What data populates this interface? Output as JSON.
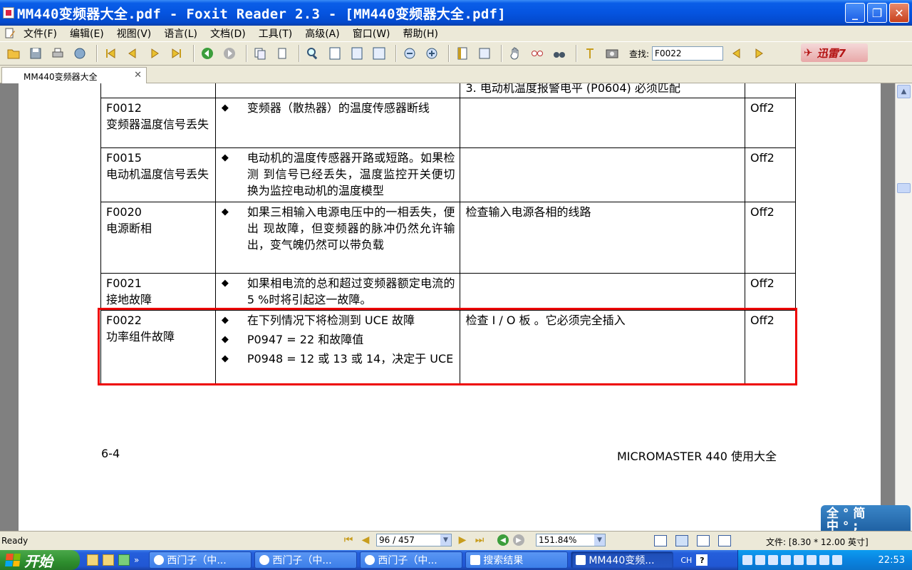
{
  "window": {
    "title": "MM440变频器大全.pdf - Foxit Reader 2.3 - [MM440变频器大全.pdf]",
    "min": "_",
    "max": "❐",
    "close": "✕"
  },
  "menu": [
    "文件(F)",
    "编辑(E)",
    "视图(V)",
    "语言(L)",
    "文档(D)",
    "工具(T)",
    "高级(A)",
    "窗口(W)",
    "帮助(H)"
  ],
  "toolbar": {
    "find_label": "查找:",
    "find_value": "F0022",
    "xunlei": "迅雷7"
  },
  "tab": {
    "label": "MM440变频器大全",
    "close": "✕"
  },
  "table": {
    "top_row_text": "3. 电动机温度报警电平 (P0604) 必须匹配",
    "rows": [
      {
        "code": "F0012",
        "name": "变频器温度信号丢失",
        "causes": [
          "变频器（散热器）的温度传感器断线"
        ],
        "action": "",
        "reaction": "Off2"
      },
      {
        "code": "F0015",
        "name": "电动机温度信号丢失",
        "causes": [
          "电动机的温度传感器开路或短路。如果检测 到信号已经丢失，温度监控开关便切换为监控电动机的温度模型"
        ],
        "action": "",
        "reaction": "Off2"
      },
      {
        "code": "F0020",
        "name": "电源断相",
        "causes": [
          "如果三相输入电源电压中的一相丢失，便出 现故障，但变频器的脉冲仍然允许输出，变气魄仍然可以带负载"
        ],
        "action": "检查输入电源各相的线路",
        "reaction": "Off2"
      },
      {
        "code": "F0021",
        "name": "接地故障",
        "causes": [
          "如果相电流的总和超过变频器额定电流的 5 %时将引起这一故障。"
        ],
        "action": "",
        "reaction": "Off2"
      },
      {
        "code": "F0022",
        "name": "功率组件故障",
        "causes": [
          "在下列情况下将检测到 UCE 故障",
          "P0947 = 22 和故障值",
          "P0948 = 12 或 13 或 14，决定于 UCE"
        ],
        "action": "检查 I / O 板 。它必须完全插入",
        "reaction": "Off2"
      }
    ]
  },
  "page_footer": {
    "left": "6-4",
    "right": "MICROMASTER 440 使用大全"
  },
  "ime": {
    "line1": "全 ° 简",
    "line2": "中 ° ;"
  },
  "status": {
    "ready": "Ready",
    "page": "96 / 457",
    "zoom": "151.84%",
    "file_size": "文件: [8.30 * 12.00 英寸]"
  },
  "taskbar": {
    "start": "开始",
    "more": "»",
    "tasks": [
      "西门子（中...",
      "西门子（中...",
      "西门子（中...",
      "搜索结果",
      "MM440变频..."
    ],
    "lang": "CH",
    "help": "?",
    "clock": "22:53"
  }
}
